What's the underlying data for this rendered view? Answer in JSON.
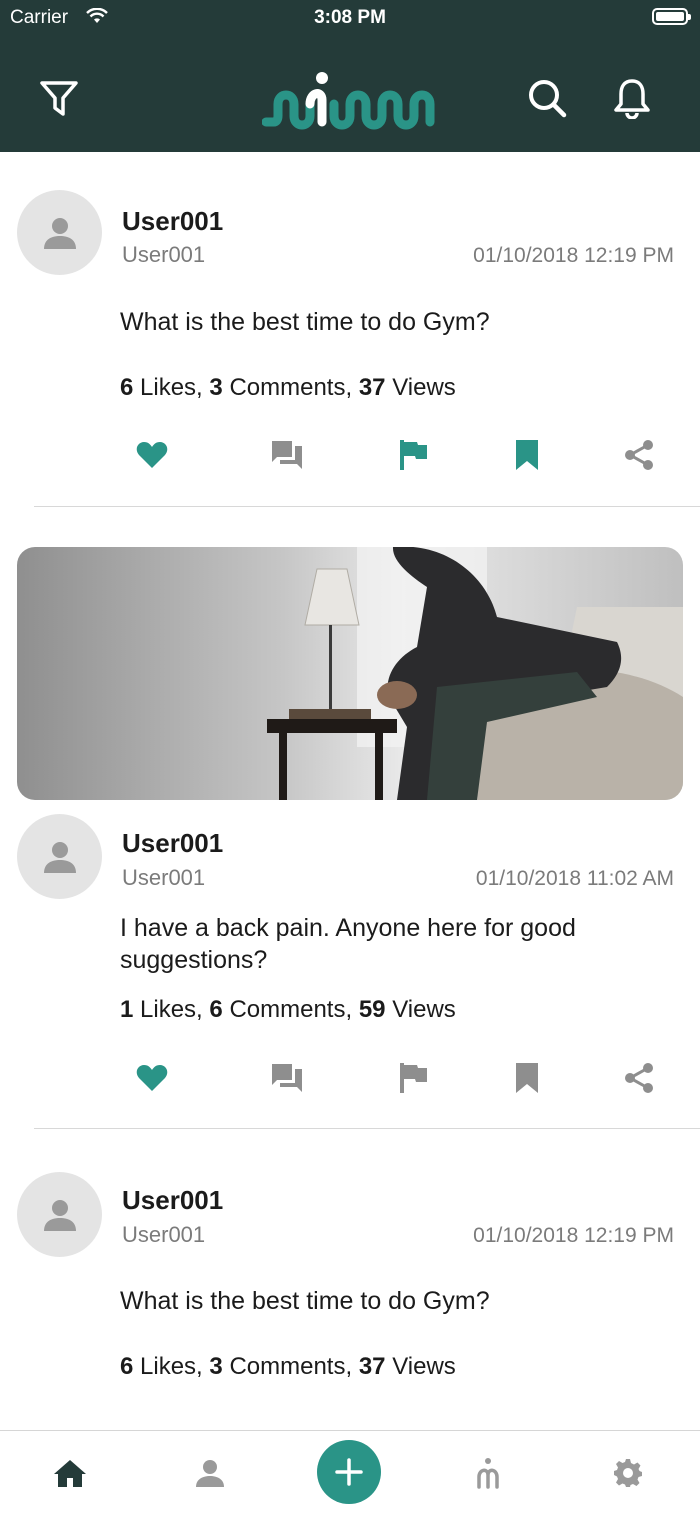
{
  "status_bar": {
    "carrier": "Carrier",
    "time": "3:08 PM"
  },
  "header": {
    "filter_icon": "filter-icon",
    "logo": "app-logo",
    "search_icon": "search-icon",
    "bell_icon": "bell-icon"
  },
  "colors": {
    "header_bg": "#243b39",
    "accent": "#2a9487",
    "muted_icon": "#8e8e8e",
    "text_secondary": "#7b7b7b"
  },
  "posts": [
    {
      "name": "User001",
      "handle": "User001",
      "date": "01/10/2018 12:19 PM",
      "question": "What is the best time to do Gym?",
      "likes": "6",
      "likes_label": "Likes,",
      "comments": "3",
      "comments_label": "Comments,",
      "views": "37",
      "views_label": "Views",
      "liked": true,
      "flagged": true,
      "bookmarked": true
    },
    {
      "image": "man-sitting-on-bed-photo",
      "name": "User001",
      "handle": "User001",
      "date": "01/10/2018 11:02 AM",
      "question": "I have a back pain. Anyone here for good suggestions?",
      "likes": "1",
      "likes_label": "Likes,",
      "comments": "6",
      "comments_label": "Comments,",
      "views": "59",
      "views_label": "Views",
      "liked": true,
      "flagged": false,
      "bookmarked": false
    },
    {
      "name": "User001",
      "handle": "User001",
      "date": "01/10/2018 12:19 PM",
      "question": "What is the best time to do Gym?",
      "likes": "6",
      "likes_label": "Likes,",
      "comments": "3",
      "comments_label": "Comments,",
      "views": "37",
      "views_label": "Views"
    }
  ],
  "tabbar": {
    "items": [
      "home-icon",
      "profile-icon",
      "add-icon",
      "activity-icon",
      "settings-icon"
    ],
    "active": "home-icon"
  }
}
